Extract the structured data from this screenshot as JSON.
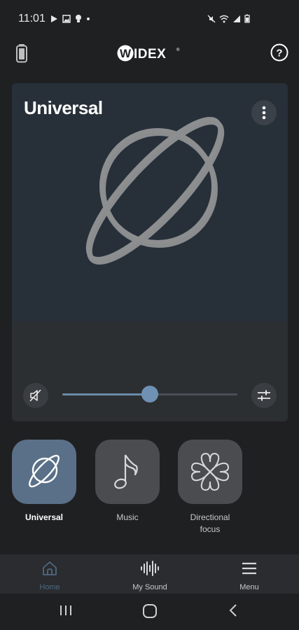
{
  "status": {
    "time": "11:01"
  },
  "app": {
    "logo": "WIDEX",
    "help_icon": "help-icon",
    "battery_icon": "battery-icon"
  },
  "card": {
    "title": "Universal",
    "illustration": "planet-icon",
    "volume_level": 0.5
  },
  "programs": [
    {
      "label": "Universal",
      "icon": "planet-icon",
      "active": true
    },
    {
      "label": "Music",
      "icon": "music-note-icon",
      "active": false
    },
    {
      "label": "Directional\nfocus",
      "icon": "clover-icon",
      "active": false
    }
  ],
  "bottom_nav": [
    {
      "label": "Home",
      "icon": "home-icon",
      "active": true
    },
    {
      "label": "My Sound",
      "icon": "soundwave-icon",
      "active": false
    },
    {
      "label": "Menu",
      "icon": "hamburger-icon",
      "active": false
    }
  ],
  "colors": {
    "accent": "#6f91b4",
    "card_top": "#273039",
    "active_tile": "#5a7088",
    "inactive_tile": "#4a4c50"
  }
}
